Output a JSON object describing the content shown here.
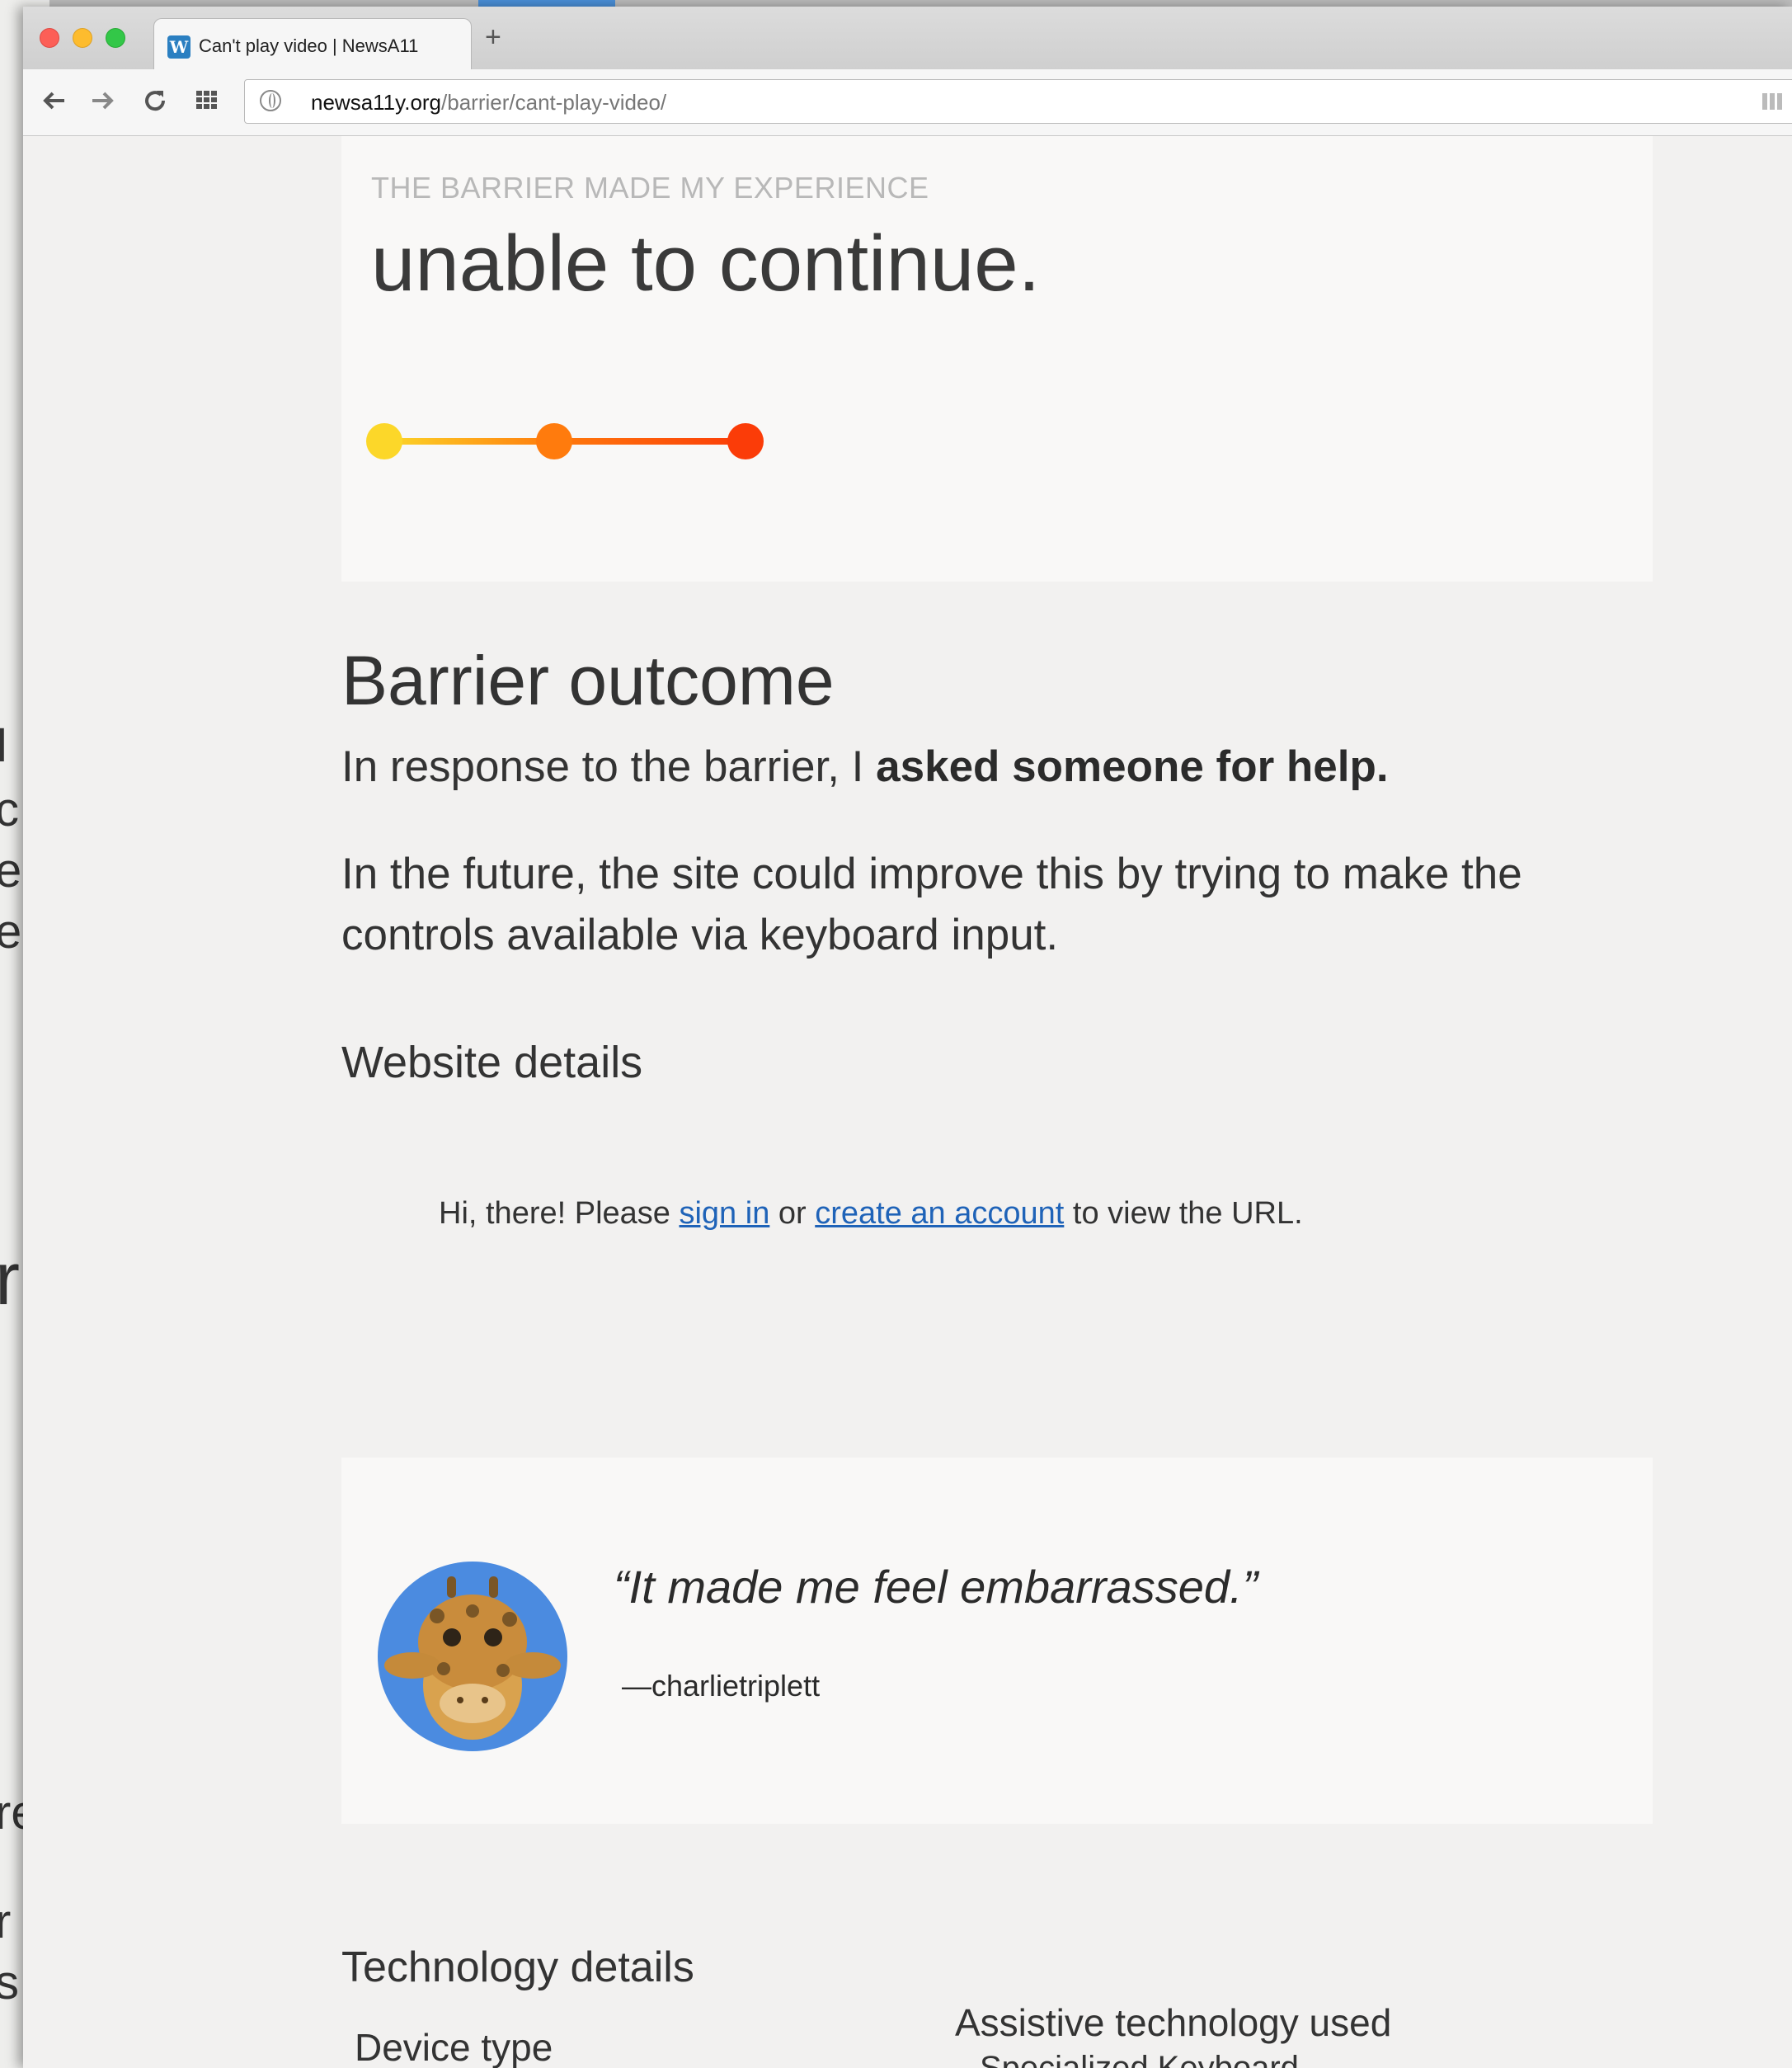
{
  "browser": {
    "tab_title": "Can't play video | NewsA11",
    "favicon": "wordpress-icon",
    "new_tab_symbol": "+",
    "url_host": "newsa11y.org",
    "url_path": "/barrier/cant-play-video/"
  },
  "experience": {
    "label": "THE BARRIER MADE MY EXPERIENCE",
    "value": "unable to continue.",
    "scale_colors": [
      "#fcd729",
      "#ff7b0d",
      "#fb3c08"
    ]
  },
  "outcome": {
    "heading": "Barrier outcome",
    "response_prefix": "In response to the barrier, I ",
    "response_bold": "asked someone for help.",
    "improvement": "In the future, the site could improve this by trying to make the controls available via keyboard input."
  },
  "website": {
    "heading": "Website details",
    "signin_prefix": "Hi, there! Please ",
    "signin_link": "sign in",
    "signin_middle": " or ",
    "create_link": "create an account",
    "signin_suffix": " to view the URL."
  },
  "quote": {
    "text": "“It made me feel embarrassed.”",
    "author": "—charlietriplett",
    "avatar": "giraffe-avatar"
  },
  "technology": {
    "heading": "Technology details",
    "device_label": "Device type",
    "at_label": "Assistive technology used",
    "at_items": [
      "Specialized Keyboard"
    ]
  },
  "background_fragments": [
    "I",
    "c",
    "e",
    "e",
    "r",
    "re",
    "r",
    "s"
  ]
}
